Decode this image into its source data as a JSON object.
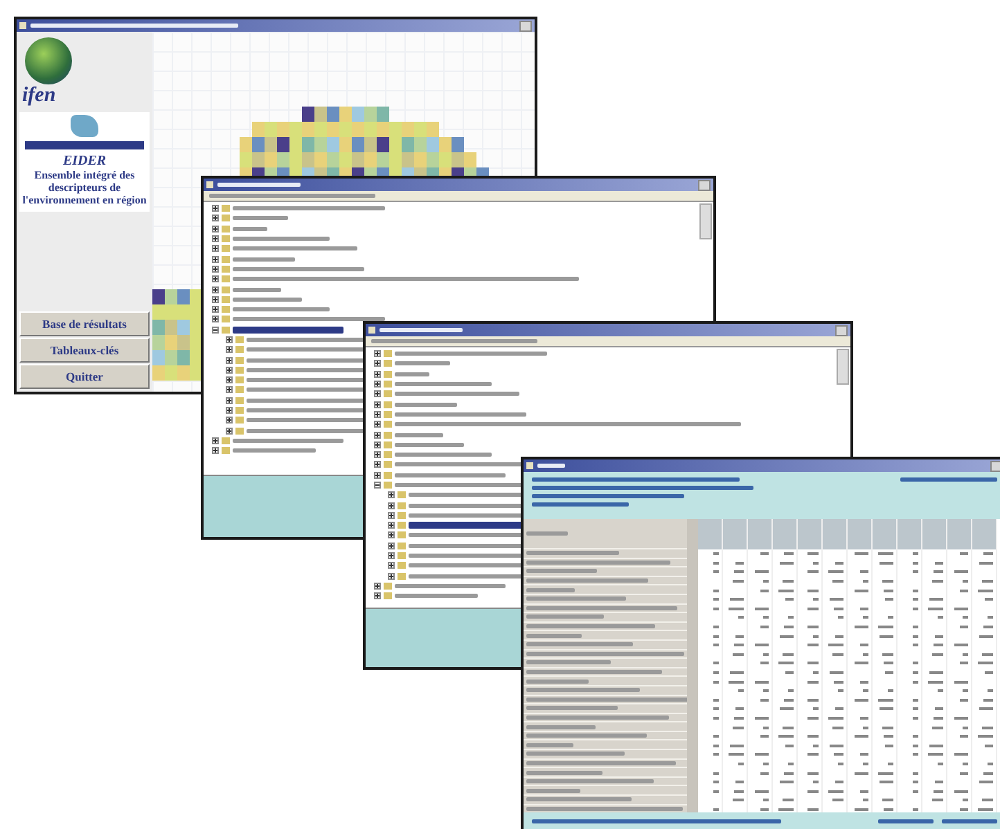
{
  "windows": [
    {
      "kind": "home",
      "logo": "ifen",
      "product": "EIDER",
      "description": "Ensemble intégré des descripteurs de l'environnement en région",
      "buttons": [
        "Base de résultats",
        "Tableaux-clés",
        "Quitter"
      ]
    },
    {
      "kind": "tree",
      "items": [
        {
          "expanded": false,
          "selected": false
        },
        {
          "expanded": false,
          "selected": false
        },
        {
          "expanded": false,
          "selected": false
        },
        {
          "expanded": false,
          "selected": false
        },
        {
          "expanded": false,
          "selected": false
        },
        {
          "expanded": false,
          "selected": false
        },
        {
          "expanded": false,
          "selected": false
        },
        {
          "expanded": false,
          "selected": false
        },
        {
          "expanded": false,
          "selected": false
        },
        {
          "expanded": false,
          "selected": false
        },
        {
          "expanded": false,
          "selected": false
        },
        {
          "expanded": false,
          "selected": false
        },
        {
          "expanded": true,
          "selected": true,
          "children": [
            {
              "expanded": false,
              "selected": false
            },
            {
              "expanded": false,
              "selected": false
            },
            {
              "expanded": false,
              "selected": false
            },
            {
              "expanded": false,
              "selected": false
            },
            {
              "expanded": false,
              "selected": false
            },
            {
              "expanded": false,
              "selected": false
            },
            {
              "expanded": false,
              "selected": false
            },
            {
              "expanded": false,
              "selected": false
            },
            {
              "expanded": false,
              "selected": false
            },
            {
              "expanded": false,
              "selected": false
            }
          ]
        },
        {
          "expanded": false,
          "selected": false
        },
        {
          "expanded": false,
          "selected": false
        }
      ]
    },
    {
      "kind": "tree",
      "items": [
        {
          "expanded": false,
          "selected": false
        },
        {
          "expanded": false,
          "selected": false
        },
        {
          "expanded": false,
          "selected": false
        },
        {
          "expanded": false,
          "selected": false
        },
        {
          "expanded": false,
          "selected": false
        },
        {
          "expanded": false,
          "selected": false
        },
        {
          "expanded": false,
          "selected": false
        },
        {
          "expanded": false,
          "selected": false
        },
        {
          "expanded": false,
          "selected": false
        },
        {
          "expanded": false,
          "selected": false
        },
        {
          "expanded": false,
          "selected": false
        },
        {
          "expanded": false,
          "selected": false
        },
        {
          "expanded": false,
          "selected": false
        },
        {
          "expanded": true,
          "selected": false,
          "children": [
            {
              "expanded": false,
              "selected": false
            },
            {
              "expanded": false,
              "selected": false
            },
            {
              "expanded": false,
              "selected": false
            },
            {
              "expanded": false,
              "selected": true
            },
            {
              "expanded": false,
              "selected": false
            },
            {
              "expanded": false,
              "selected": false
            },
            {
              "expanded": false,
              "selected": false
            },
            {
              "expanded": false,
              "selected": false
            },
            {
              "expanded": false,
              "selected": false
            }
          ]
        },
        {
          "expanded": false,
          "selected": false
        },
        {
          "expanded": false,
          "selected": false
        }
      ]
    },
    {
      "kind": "table"
    }
  ]
}
